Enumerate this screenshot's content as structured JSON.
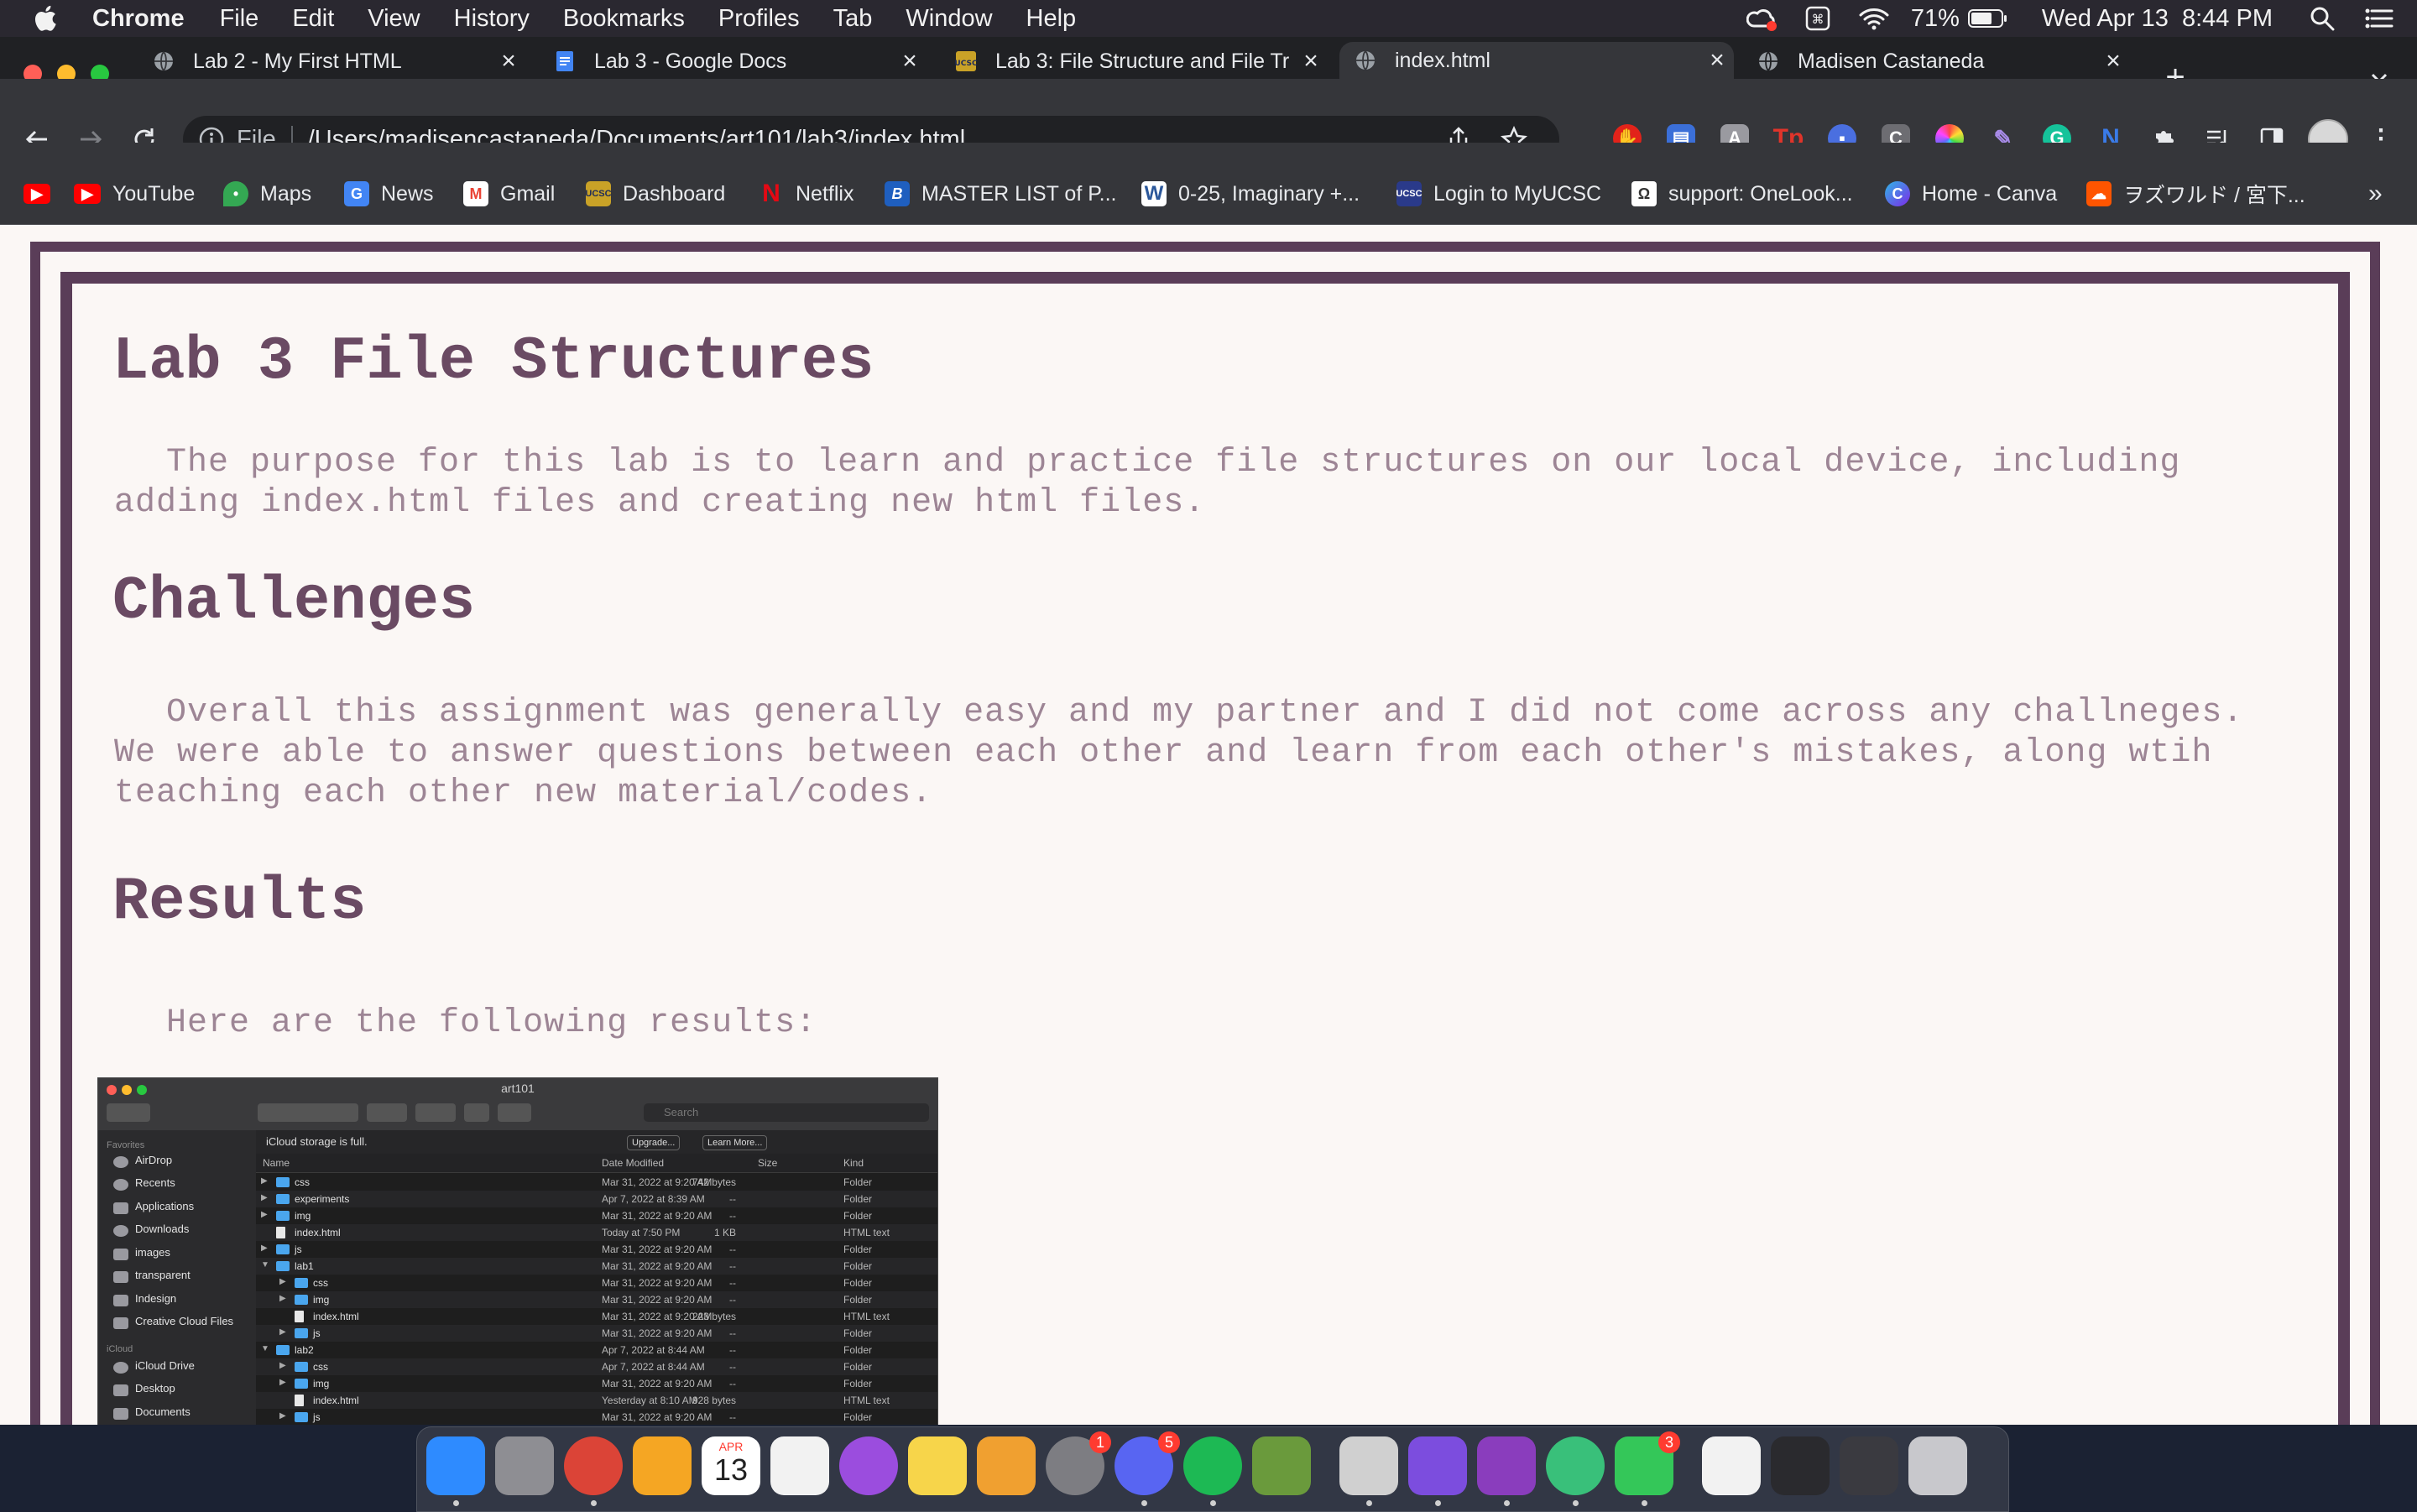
{
  "menubar": {
    "app_name": "Chrome",
    "items": [
      "File",
      "Edit",
      "View",
      "History",
      "Bookmarks",
      "Profiles",
      "Tab",
      "Window",
      "Help"
    ],
    "battery": "71%",
    "clock": "Wed Apr 13  8:44 PM"
  },
  "tabs": [
    {
      "title": "Lab 2 - My First HTML",
      "icon": "globe-icon"
    },
    {
      "title": "Lab 3 - Google Docs",
      "icon": "google-docs-icon"
    },
    {
      "title": "Lab 3: File Structure and File Tr",
      "icon": "ucsc-icon"
    },
    {
      "title": "index.html",
      "icon": "globe-icon"
    },
    {
      "title": "Madisen Castaneda",
      "icon": "globe-icon"
    }
  ],
  "omnibox": {
    "scheme": "File",
    "url": "/Users/madisencastaneda/Documents/art101/lab3/index.html"
  },
  "bookmarks": [
    {
      "label": "",
      "icon": "youtube-icon",
      "color": "#ff0000"
    },
    {
      "label": "YouTube",
      "icon": "youtube-icon",
      "color": "#ff0000"
    },
    {
      "label": "Maps",
      "icon": "maps-icon",
      "color": "#34a853"
    },
    {
      "label": "News",
      "icon": "news-icon",
      "color": "#4285f4"
    },
    {
      "label": "Gmail",
      "icon": "gmail-icon",
      "color": "#ea4335"
    },
    {
      "label": "Dashboard",
      "icon": "ucsc-icon",
      "color": "#c9a227"
    },
    {
      "label": "Netflix",
      "icon": "netflix-icon",
      "color": "#e50914"
    },
    {
      "label": "MASTER LIST of P...",
      "icon": "bookmark-b-icon",
      "color": "#1f5fbf"
    },
    {
      "label": "0-25, Imaginary +...",
      "icon": "wordpress-icon",
      "color": "#2b579a"
    },
    {
      "label": "Login to MyUCSC",
      "icon": "ucsc-icon",
      "color": "#2a3a8a"
    },
    {
      "label": "support: OneLook...",
      "icon": "onelook-icon",
      "color": "#ffffff"
    },
    {
      "label": "Home - Canva",
      "icon": "canva-icon",
      "color": "#2fb6e6"
    },
    {
      "label": "ヲズワルド / 宮下...",
      "icon": "soundcloud-icon",
      "color": "#ff5500"
    }
  ],
  "bookmarks_overflow": "»",
  "page": {
    "title": "Lab 3 File Structures",
    "intro": "The purpose for this lab is to learn and practice file structures on our local device, including adding index.html files and creating new html files.",
    "challenges_heading": "Challenges",
    "challenges_text": "Overall this assignment was generally easy and my partner and I did not come across any challneges. We were able to answer questions between each other and learn from each other's mistakes, along wtih teaching each other new material/codes.",
    "results_heading": "Results",
    "results_text": "Here are the following results:"
  },
  "finder": {
    "title": "art101",
    "search_placeholder": "Search",
    "banner": "iCloud storage is full.",
    "upgrade": "Upgrade...",
    "learn_more": "Learn More...",
    "sidebar": {
      "favorites_heading": "Favorites",
      "favorites": [
        "AirDrop",
        "Recents",
        "Applications",
        "Downloads",
        "images",
        "transparent",
        "Indesign",
        "Creative Cloud Files"
      ],
      "icloud_heading": "iCloud",
      "icloud": [
        "iCloud Drive",
        "Desktop",
        "Documents"
      ]
    },
    "columns": {
      "name": "Name",
      "date": "Date Modified",
      "size": "Size",
      "kind": "Kind"
    },
    "rows": [
      {
        "name": "css",
        "date": "Mar 31, 2022 at 9:20 AM",
        "size": "742 bytes",
        "kind": "Folder",
        "indent": 0,
        "folder": true,
        "tri": "▶"
      },
      {
        "name": "experiments",
        "date": "Apr 7, 2022 at 8:39 AM",
        "size": "--",
        "kind": "Folder",
        "indent": 0,
        "folder": true,
        "tri": "▶"
      },
      {
        "name": "img",
        "date": "Mar 31, 2022 at 9:20 AM",
        "size": "--",
        "kind": "Folder",
        "indent": 0,
        "folder": true,
        "tri": "▶"
      },
      {
        "name": "index.html",
        "date": "Today at 7:50 PM",
        "size": "1 KB",
        "kind": "HTML text",
        "indent": 0,
        "folder": false,
        "tri": ""
      },
      {
        "name": "js",
        "date": "Mar 31, 2022 at 9:20 AM",
        "size": "--",
        "kind": "Folder",
        "indent": 0,
        "folder": true,
        "tri": "▶"
      },
      {
        "name": "lab1",
        "date": "Mar 31, 2022 at 9:20 AM",
        "size": "--",
        "kind": "Folder",
        "indent": 0,
        "folder": true,
        "tri": "▼"
      },
      {
        "name": "css",
        "date": "Mar 31, 2022 at 9:20 AM",
        "size": "--",
        "kind": "Folder",
        "indent": 1,
        "folder": true,
        "tri": "▶"
      },
      {
        "name": "img",
        "date": "Mar 31, 2022 at 9:20 AM",
        "size": "--",
        "kind": "Folder",
        "indent": 1,
        "folder": true,
        "tri": "▶"
      },
      {
        "name": "index.html",
        "date": "Mar 31, 2022 at 9:20 AM",
        "size": "223 bytes",
        "kind": "HTML text",
        "indent": 1,
        "folder": false,
        "tri": ""
      },
      {
        "name": "js",
        "date": "Mar 31, 2022 at 9:20 AM",
        "size": "--",
        "kind": "Folder",
        "indent": 1,
        "folder": true,
        "tri": "▶"
      },
      {
        "name": "lab2",
        "date": "Apr 7, 2022 at 8:44 AM",
        "size": "--",
        "kind": "Folder",
        "indent": 0,
        "folder": true,
        "tri": "▼"
      },
      {
        "name": "css",
        "date": "Apr 7, 2022 at 8:44 AM",
        "size": "--",
        "kind": "Folder",
        "indent": 1,
        "folder": true,
        "tri": "▶"
      },
      {
        "name": "img",
        "date": "Mar 31, 2022 at 9:20 AM",
        "size": "--",
        "kind": "Folder",
        "indent": 1,
        "folder": true,
        "tri": "▶"
      },
      {
        "name": "index.html",
        "date": "Yesterday at 8:10 AM",
        "size": "928 bytes",
        "kind": "HTML text",
        "indent": 1,
        "folder": false,
        "tri": ""
      },
      {
        "name": "js",
        "date": "Mar 31, 2022 at 9:20 AM",
        "size": "--",
        "kind": "Folder",
        "indent": 1,
        "folder": true,
        "tri": "▶"
      }
    ]
  },
  "dock": {
    "apps": [
      {
        "name": "finder-icon",
        "color": "#2e8bff"
      },
      {
        "name": "launchpad-icon",
        "color": "#8e8e93"
      },
      {
        "name": "chrome-icon",
        "color": "#db4437"
      },
      {
        "name": "photos-icon",
        "color": "#f5a623"
      },
      {
        "name": "calendar-icon",
        "color": "#ffffff"
      },
      {
        "name": "reminders-icon",
        "color": "#f2f2f2"
      },
      {
        "name": "podcasts-icon",
        "color": "#9b4dde"
      },
      {
        "name": "notes-icon",
        "color": "#f7d54a"
      },
      {
        "name": "keynote-icon",
        "color": "#f0a030"
      },
      {
        "name": "system-preferences-icon",
        "color": "#7d7d82"
      },
      {
        "name": "discord-icon",
        "color": "#5865f2"
      },
      {
        "name": "spotify-icon",
        "color": "#1db954"
      },
      {
        "name": "minecraft-icon",
        "color": "#6a9a3c"
      },
      {
        "name": "printer-icon",
        "color": "#d0d0d0"
      },
      {
        "name": "obsidian-icon",
        "color": "#7c4dde"
      },
      {
        "name": "github-desktop-icon",
        "color": "#8a3dbd"
      },
      {
        "name": "atom-icon",
        "color": "#39c07a"
      },
      {
        "name": "facetime-icon",
        "color": "#34c759"
      },
      {
        "name": "document-icon",
        "color": "#f2f2f2"
      },
      {
        "name": "window-thumbnail-icon",
        "color": "#2a2a2e"
      },
      {
        "name": "window-thumbnail-icon",
        "color": "#3a3a40"
      },
      {
        "name": "trash-icon",
        "color": "#c8c8cc"
      }
    ],
    "calendar_month": "APR",
    "calendar_day": "13",
    "badges": {
      "system_preferences": "1",
      "discord": "5",
      "facetime": "3"
    }
  }
}
